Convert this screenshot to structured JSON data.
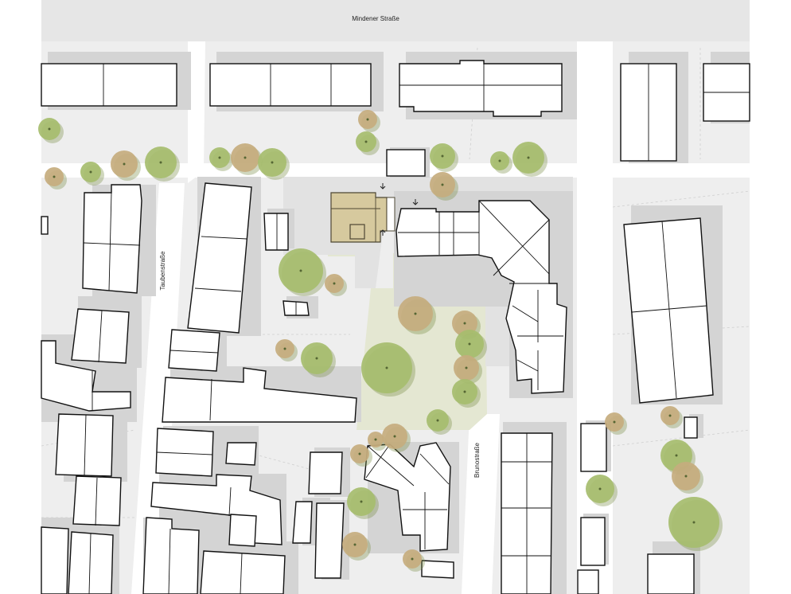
{
  "map": {
    "title": "",
    "street_labels": {
      "mindener": "Mindener Straße",
      "tauben": "Taubenstraße",
      "bruno": "Brunostraße"
    },
    "colors": {
      "background": "#ffffff",
      "ground": "#eeeeee",
      "building_fill": "#ffffff",
      "building_outline": "#111111",
      "building_shadow": "#d4d4d4",
      "proposed_building": "#d6c99e",
      "lawn": "#e4e7d2",
      "tree_green": "#a6bd6e",
      "tree_brown": "#c6ad7e"
    },
    "legend": "none",
    "icons": [
      "north-arrow-entrance-icon",
      "tree-icon"
    ]
  }
}
